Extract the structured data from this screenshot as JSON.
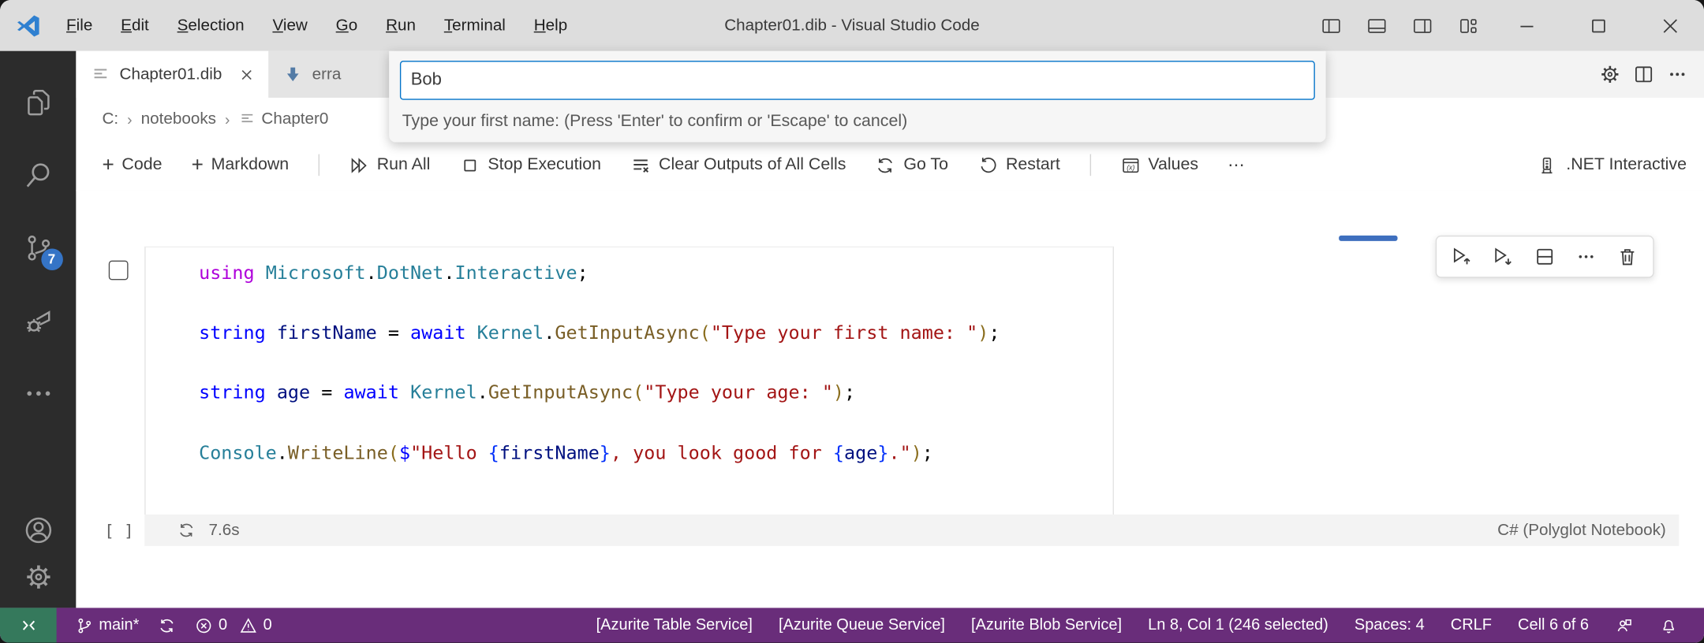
{
  "colors": {
    "accent_blue": "#0273c9",
    "status_bar_purple": "#692d7a",
    "remote_green": "#35795c",
    "badge_blue": "#3574c6",
    "activity_bar_bg": "#2c2c2c",
    "titlebar_bg": "#dddddd",
    "cell_indicator_blue": "#3e6fbe"
  },
  "titlebar": {
    "title": "Chapter01.dib - Visual Studio Code",
    "menus": [
      "File",
      "Edit",
      "Selection",
      "View",
      "Go",
      "Run",
      "Terminal",
      "Help"
    ]
  },
  "activity_bar": {
    "scm_badge": "7"
  },
  "tabs": {
    "active_label": "Chapter01.dib",
    "second_label": "erra"
  },
  "breadcrumb": {
    "drive": "C:",
    "folder": "notebooks",
    "file": "Chapter0",
    "sep": "›"
  },
  "quick_input": {
    "value": "Bob",
    "message": "Type your first name: (Press 'Enter' to confirm or 'Escape' to cancel)"
  },
  "toolbar": {
    "code": "Code",
    "markdown": "Markdown",
    "run_all": "Run All",
    "stop": "Stop Execution",
    "clear": "Clear Outputs of All Cells",
    "goto": "Go To",
    "restart": "Restart",
    "values": "Values",
    "more": "⋯",
    "kernel": ".NET Interactive",
    "plus": "+"
  },
  "cell": {
    "exec_count": "[ ]",
    "duration": "7.6s",
    "language": "C# (Polyglot Notebook)",
    "code_lines": [
      [
        {
          "t": "using",
          "c": "kwc"
        },
        {
          "t": " ",
          "c": "pl"
        },
        {
          "t": "Microsoft",
          "c": "type"
        },
        {
          "t": ".",
          "c": "pl"
        },
        {
          "t": "DotNet",
          "c": "type"
        },
        {
          "t": ".",
          "c": "pl"
        },
        {
          "t": "Interactive",
          "c": "type"
        },
        {
          "t": ";",
          "c": "pl"
        }
      ],
      [],
      [
        {
          "t": "string",
          "c": "kw"
        },
        {
          "t": " ",
          "c": "pl"
        },
        {
          "t": "firstName",
          "c": "var"
        },
        {
          "t": " = ",
          "c": "pl"
        },
        {
          "t": "await",
          "c": "kw"
        },
        {
          "t": " ",
          "c": "pl"
        },
        {
          "t": "Kernel",
          "c": "type"
        },
        {
          "t": ".",
          "c": "pl"
        },
        {
          "t": "GetInputAsync",
          "c": "fn"
        },
        {
          "t": "(",
          "c": "paren"
        },
        {
          "t": "\"Type your first name: \"",
          "c": "str"
        },
        {
          "t": ")",
          "c": "paren"
        },
        {
          "t": ";",
          "c": "pl"
        }
      ],
      [],
      [
        {
          "t": "string",
          "c": "kw"
        },
        {
          "t": " ",
          "c": "pl"
        },
        {
          "t": "age",
          "c": "var"
        },
        {
          "t": " = ",
          "c": "pl"
        },
        {
          "t": "await",
          "c": "kw"
        },
        {
          "t": " ",
          "c": "pl"
        },
        {
          "t": "Kernel",
          "c": "type"
        },
        {
          "t": ".",
          "c": "pl"
        },
        {
          "t": "GetInputAsync",
          "c": "fn"
        },
        {
          "t": "(",
          "c": "paren"
        },
        {
          "t": "\"Type your age: \"",
          "c": "str"
        },
        {
          "t": ")",
          "c": "paren"
        },
        {
          "t": ";",
          "c": "pl"
        }
      ],
      [],
      [
        {
          "t": "Console",
          "c": "type"
        },
        {
          "t": ".",
          "c": "pl"
        },
        {
          "t": "WriteLine",
          "c": "fn"
        },
        {
          "t": "(",
          "c": "paren"
        },
        {
          "t": "$",
          "c": "kw"
        },
        {
          "t": "\"Hello ",
          "c": "str"
        },
        {
          "t": "{",
          "c": "brace"
        },
        {
          "t": "firstName",
          "c": "var"
        },
        {
          "t": "}",
          "c": "brace"
        },
        {
          "t": ", you look good for ",
          "c": "str"
        },
        {
          "t": "{",
          "c": "brace"
        },
        {
          "t": "age",
          "c": "var"
        },
        {
          "t": "}",
          "c": "brace"
        },
        {
          "t": ".\"",
          "c": "str"
        },
        {
          "t": ")",
          "c": "paren"
        },
        {
          "t": ";",
          "c": "pl"
        }
      ],
      []
    ]
  },
  "status_bar": {
    "branch": "main*",
    "errors": "0",
    "warnings": "0",
    "azurite": [
      "[Azurite Table Service]",
      "[Azurite Queue Service]",
      "[Azurite Blob Service]"
    ],
    "cursor": "Ln 8, Col 1 (246 selected)",
    "indent": "Spaces: 4",
    "eol": "CRLF",
    "cell_pos": "Cell 6 of 6"
  }
}
